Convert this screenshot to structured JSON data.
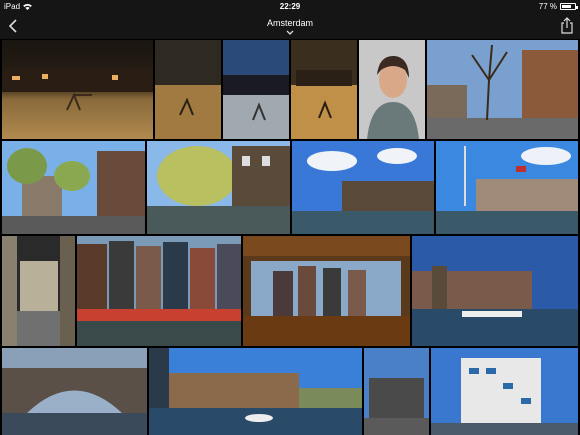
{
  "status_bar": {
    "device": "iPad",
    "time": "22:29",
    "battery_percent": "77 %",
    "battery_level": 0.77
  },
  "nav": {
    "title": "Amsterdam"
  },
  "icons": {
    "back": "chevron-left-icon",
    "share": "share-icon",
    "title_menu": "chevron-down-icon"
  },
  "photos": [
    {
      "id": "night-playground"
    },
    {
      "id": "night-playground-2"
    },
    {
      "id": "night-blue-sky"
    },
    {
      "id": "night-orange"
    },
    {
      "id": "portrait-woman"
    },
    {
      "id": "tree-houses"
    },
    {
      "id": "street-trees"
    },
    {
      "id": "canal-trees"
    },
    {
      "id": "canal-bridge"
    },
    {
      "id": "canal-flags"
    },
    {
      "id": "alley"
    },
    {
      "id": "canal-houses-facades"
    },
    {
      "id": "boat-window"
    },
    {
      "id": "canal-boats-blue"
    },
    {
      "id": "bridge-arch"
    },
    {
      "id": "canal-speedboat"
    },
    {
      "id": "tower-street"
    },
    {
      "id": "bridge-people"
    },
    {
      "id": "modern-building"
    }
  ]
}
